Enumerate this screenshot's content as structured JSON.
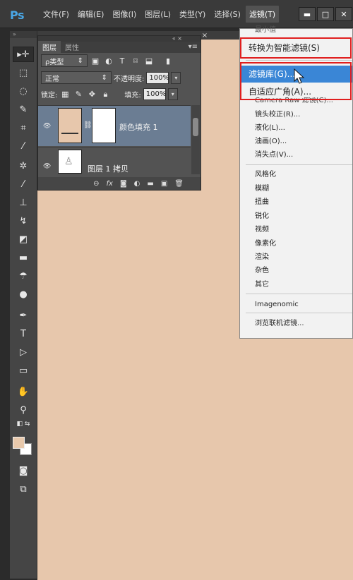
{
  "app": {
    "logo": "Ps"
  },
  "menubar": {
    "items": [
      "文件(F)",
      "编辑(E)",
      "图像(I)",
      "图层(L)",
      "类型(Y)",
      "选择(S)",
      "滤镜(T)"
    ],
    "active_index": 6,
    "window_buttons": [
      "minimize",
      "maximize",
      "close"
    ]
  },
  "toolbar": {
    "tools": [
      "move-tool",
      "marquee-tool",
      "lasso-tool",
      "quick-select-tool",
      "crop-tool",
      "eyedropper-tool",
      "healing-tool",
      "brush-tool",
      "stamp-tool",
      "history-brush-tool",
      "eraser-tool",
      "gradient-tool",
      "blur-tool",
      "dodge-tool",
      "pen-tool",
      "type-tool",
      "path-select-tool",
      "shape-tool",
      "hand-tool",
      "zoom-tool"
    ],
    "foreground_color": "#e8c9ac",
    "background_color": "#ffffff"
  },
  "canvas": {
    "color": "#e7c7ac"
  },
  "layers_panel": {
    "tabs": [
      "图层",
      "属性"
    ],
    "active_tab": 0,
    "filter_label": "ρ类型",
    "blend_mode": "正常",
    "opacity_label": "不透明度:",
    "opacity_value": "100%",
    "lock_label": "锁定:",
    "fill_label": "填充:",
    "fill_value": "100%",
    "layers": [
      {
        "name": "颜色填充 1",
        "selected": true,
        "thumb_color": "#e7c7ac"
      },
      {
        "name": "图层 1 拷贝",
        "selected": false
      }
    ],
    "footer_icons": [
      "link-icon",
      "fx-icon",
      "mask-icon",
      "adjustment-icon",
      "folder-icon",
      "new-layer-icon",
      "trash-icon"
    ]
  },
  "filter_menu": {
    "items": [
      {
        "label": "最小值",
        "partial": true
      },
      {
        "label": "转换为智能滤镜(S)",
        "big": true,
        "boxed": true
      },
      {
        "label": "滤镜库(G)...",
        "big": true,
        "highlight": true,
        "boxed": true
      },
      {
        "label": "自适应广角(A)...",
        "big": true,
        "boxed": true
      },
      {
        "label": "Camera Raw 滤镜(C)...",
        "partial": true
      },
      {
        "label": "镜头校正(R)..."
      },
      {
        "label": "液化(L)..."
      },
      {
        "label": "油画(O)..."
      },
      {
        "label": "消失点(V)..."
      },
      {
        "label": "风格化"
      },
      {
        "label": "模糊"
      },
      {
        "label": "扭曲"
      },
      {
        "label": "锐化"
      },
      {
        "label": "视频"
      },
      {
        "label": "像素化"
      },
      {
        "label": "渲染"
      },
      {
        "label": "杂色"
      },
      {
        "label": "其它"
      },
      {
        "label": "Imagenomic"
      },
      {
        "label": "浏览联机滤镜..."
      }
    ],
    "highlight_color": "#3a86d6",
    "box_color": "#e01e1e"
  }
}
